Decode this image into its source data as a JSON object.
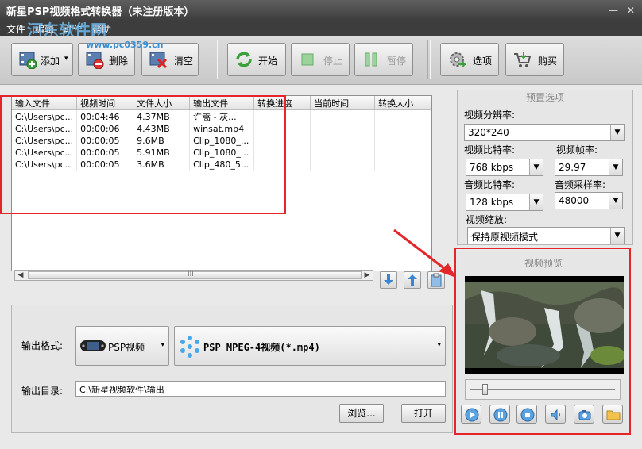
{
  "window": {
    "title": "新星PSP视频格式转换器（未注册版本）",
    "controls": [
      "—",
      "✕"
    ]
  },
  "watermark": {
    "text": "河东软件网",
    "url": "www.pc0359.cn"
  },
  "menu": [
    "文件",
    "编辑",
    "动作",
    "帮助"
  ],
  "toolbar": {
    "add": "添加",
    "delete": "删除",
    "clear": "清空",
    "start": "开始",
    "stop": "停止",
    "pause": "暂停",
    "options": "选项",
    "buy": "购买"
  },
  "file_list": {
    "columns": [
      "输入文件",
      "视频时间",
      "文件大小",
      "输出文件",
      "转换进度",
      "当前时间",
      "转换大小"
    ],
    "rows": [
      [
        "C:\\Users\\pc...",
        "00:04:46",
        "4.37MB",
        "许嵩 - 灰..."
      ],
      [
        "C:\\Users\\pc...",
        "00:00:06",
        "4.43MB",
        "winsat.mp4"
      ],
      [
        "C:\\Users\\pc...",
        "00:00:05",
        "9.6MB",
        "Clip_1080_..."
      ],
      [
        "C:\\Users\\pc...",
        "00:00:05",
        "5.91MB",
        "Clip_1080_..."
      ],
      [
        "C:\\Users\\pc...",
        "00:00:05",
        "3.6MB",
        "Clip_480_5..."
      ]
    ],
    "scroll_grip": "III"
  },
  "output": {
    "format_label": "输出格式:",
    "device": "PSP视频",
    "format": "PSP MPEG-4视频(*.mp4)",
    "dir_label": "输出目录:",
    "dir_value": "C:\\新星视频软件\\输出",
    "browse": "浏览...",
    "open": "打开"
  },
  "presets": {
    "title": "预置选项",
    "resolution_label": "视频分辨率:",
    "resolution": "320*240",
    "vbitrate_label": "视频比特率:",
    "vbitrate": "768 kbps",
    "framerate_label": "视频帧率:",
    "framerate": "29.97",
    "abitrate_label": "音频比特率:",
    "abitrate": "128 kbps",
    "samplerate_label": "音频采样率:",
    "samplerate": "48000",
    "scale_label": "视频缩放:",
    "scale": "保持原视频模式"
  },
  "preview": {
    "title": "视频预览",
    "position": 0.08
  },
  "colors": {
    "highlight": "#e4262a",
    "titlebar": "#4a4a4a"
  }
}
